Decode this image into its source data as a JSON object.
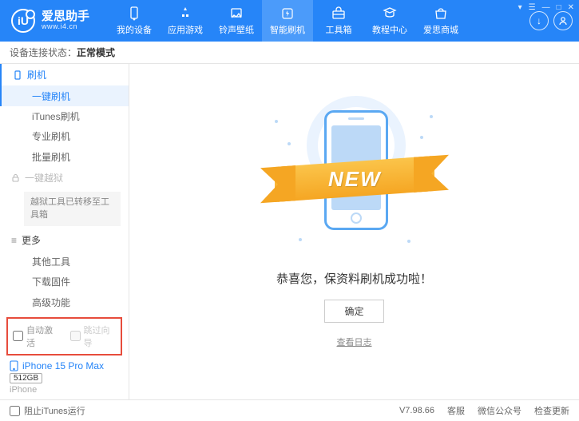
{
  "logo": {
    "title": "爱思助手",
    "sub": "www.i4.cn",
    "mark": "iU"
  },
  "nav": {
    "items": [
      "我的设备",
      "应用游戏",
      "铃声壁纸",
      "智能刷机",
      "工具箱",
      "教程中心",
      "爱思商城"
    ]
  },
  "winControls": {
    "menu": "▾",
    "list": "☰",
    "min": "—",
    "max": "□",
    "close": "✕"
  },
  "status": {
    "label": "设备连接状态：",
    "value": "正常模式"
  },
  "sidebar": {
    "group1": {
      "title": "刷机",
      "items": [
        "一键刷机",
        "iTunes刷机",
        "专业刷机",
        "批量刷机"
      ]
    },
    "group2": {
      "title": "一键越狱",
      "note": "越狱工具已转移至工具箱"
    },
    "group3": {
      "title": "更多",
      "items": [
        "其他工具",
        "下载固件",
        "高级功能"
      ]
    },
    "redbox": {
      "chk1": "自动激活",
      "chk2": "跳过向导"
    },
    "device": {
      "name": "iPhone 15 Pro Max",
      "storage": "512GB",
      "type": "iPhone"
    }
  },
  "main": {
    "ribbon": "NEW",
    "success": "恭喜您，保资料刷机成功啦！",
    "okBtn": "确定",
    "logLink": "查看日志"
  },
  "footer": {
    "blockItunes": "阻止iTunes运行",
    "version": "V7.98.66",
    "links": [
      "客服",
      "微信公众号",
      "检查更新"
    ]
  }
}
